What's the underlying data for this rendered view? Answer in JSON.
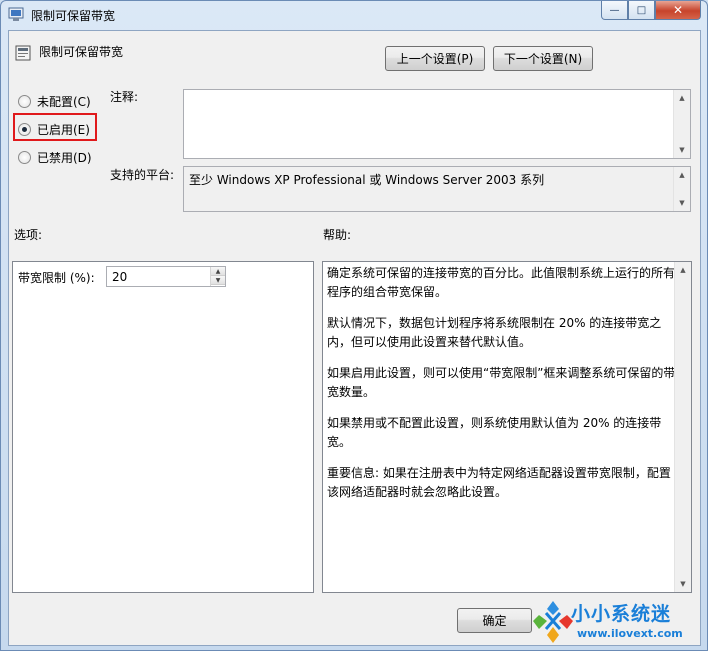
{
  "window": {
    "title": "限制可保留带宽",
    "close_glyph": "✕",
    "minimize_glyph": "—",
    "maximize_glyph": "□"
  },
  "header": {
    "policy_title": "限制可保留带宽",
    "prev_setting": "上一个设置(P)",
    "next_setting": "下一个设置(N)"
  },
  "state": {
    "options": [
      {
        "label": "未配置(C)",
        "checked": false
      },
      {
        "label": "已启用(E)",
        "checked": true
      },
      {
        "label": "已禁用(D)",
        "checked": false
      }
    ]
  },
  "comment": {
    "label": "注释:",
    "value": ""
  },
  "platform": {
    "label": "支持的平台:",
    "value": "至少 Windows XP Professional 或 Windows Server 2003 系列"
  },
  "options_section": {
    "label": "选项:",
    "bandwidth_label": "带宽限制 (%):",
    "bandwidth_value": "20"
  },
  "help_section": {
    "label": "帮助:",
    "paragraphs": [
      "确定系统可保留的连接带宽的百分比。此值限制系统上运行的所有程序的组合带宽保留。",
      "默认情况下，数据包计划程序将系统限制在 20% 的连接带宽之内，但可以使用此设置来替代默认值。",
      "如果启用此设置，则可以使用“带宽限制”框来调整系统可保留的带宽数量。",
      "如果禁用或不配置此设置，则系统使用默认值为 20% 的连接带宽。",
      "重要信息: 如果在注册表中为特定网络适配器设置带宽限制，配置该网络适配器时就会忽略此设置。"
    ]
  },
  "footer": {
    "ok_label": "确定"
  },
  "watermark": {
    "title": "小小系统迷",
    "url": "www.ilovext.com"
  },
  "colors": {
    "highlight_box": "#e0191b",
    "watermark": "#1a7fd8"
  }
}
